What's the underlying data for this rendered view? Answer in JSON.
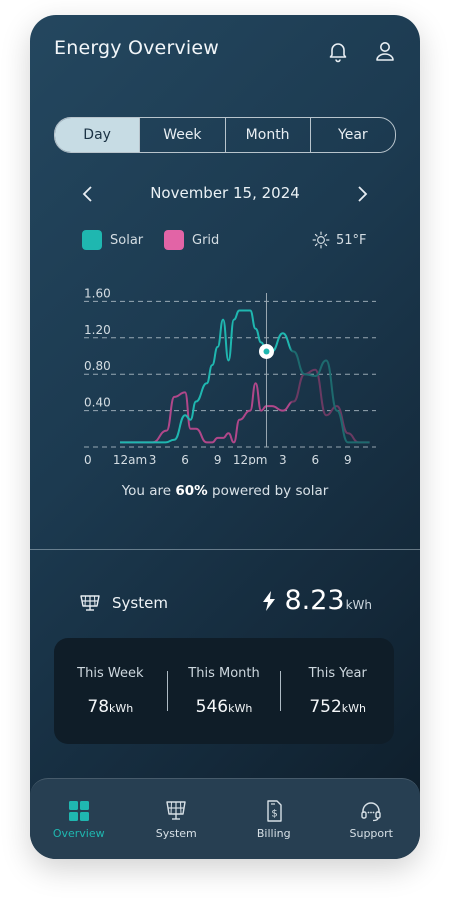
{
  "header": {
    "title": "Energy Overview",
    "notification_icon": "bell-icon",
    "profile_icon": "user-icon"
  },
  "range_tabs": [
    {
      "label": "Day",
      "active": true
    },
    {
      "label": "Week",
      "active": false
    },
    {
      "label": "Month",
      "active": false
    },
    {
      "label": "Year",
      "active": false
    }
  ],
  "date_nav": {
    "date": "November 15, 2024"
  },
  "legend": {
    "solar": "Solar",
    "grid": "Grid",
    "temperature": "51°F"
  },
  "colors": {
    "solar": "#1fb7b0",
    "grid": "#b1478a",
    "active_tab": "#1fb7b0",
    "segment_active": "#c7dce4"
  },
  "chart_data": {
    "type": "line",
    "ylim": [
      0,
      2.0
    ],
    "y_ticks": [
      "0",
      "0.40",
      "0.80",
      "1.20",
      "1.60"
    ],
    "y_tick_values": [
      0,
      0.4,
      0.8,
      1.2,
      1.6
    ],
    "x_ticks": [
      "12am",
      "3",
      "6",
      "9",
      "12pm",
      "3",
      "6",
      "9"
    ],
    "x_tick_hours": [
      0,
      3,
      6,
      9,
      12,
      15,
      18,
      21
    ],
    "xlim": [
      0,
      23.5
    ],
    "cursor_hour": 13.5,
    "series": [
      {
        "name": "Solar",
        "x": [
          0,
          3,
          4.2,
          5,
          6,
          6.5,
          7,
          8,
          8.5,
          9,
          9.5,
          10,
          10.5,
          11,
          12,
          12.5,
          13,
          13.5,
          14,
          15,
          16,
          17,
          18,
          19,
          20,
          21,
          22,
          22.5,
          23
        ],
        "y": [
          0.05,
          0.05,
          0.05,
          0.08,
          0.35,
          0.3,
          0.5,
          0.7,
          0.9,
          1.1,
          1.4,
          0.95,
          1.4,
          1.5,
          1.5,
          1.3,
          1.15,
          1.05,
          1.05,
          1.25,
          1.05,
          0.8,
          0.78,
          0.95,
          0.4,
          0.05,
          0.05,
          0.05,
          0.05
        ]
      },
      {
        "name": "Grid",
        "x": [
          0,
          3,
          4.3,
          5,
          6,
          6.5,
          7,
          8,
          8.5,
          9,
          9.5,
          10,
          10.5,
          11,
          12,
          12.5,
          13,
          13.5,
          14,
          15,
          16,
          17,
          18,
          19,
          20,
          21,
          22,
          22.5,
          23
        ],
        "y": [
          0.05,
          0.05,
          0.18,
          0.55,
          0.6,
          0.2,
          0.2,
          0.05,
          0.05,
          0.1,
          0.1,
          0.15,
          0.05,
          0.3,
          0.4,
          0.7,
          0.4,
          0.45,
          0.45,
          0.4,
          0.5,
          0.8,
          0.85,
          0.35,
          0.45,
          0.15,
          0.05,
          0.05,
          0.05
        ]
      }
    ]
  },
  "solar_message": {
    "prefix": "You are ",
    "percent": "60%",
    "suffix": " powered by solar"
  },
  "system": {
    "label": "System",
    "value": "8.23",
    "unit": "kWh"
  },
  "stats": [
    {
      "label": "This Week",
      "value": "78",
      "unit": "kWh"
    },
    {
      "label": "This Month",
      "value": "546",
      "unit": "kWh"
    },
    {
      "label": "This Year",
      "value": "752",
      "unit": "kWh"
    }
  ],
  "tabbar": [
    {
      "label": "Overview",
      "icon": "grid-icon",
      "active": true
    },
    {
      "label": "System",
      "icon": "solar-panel-icon",
      "active": false
    },
    {
      "label": "Billing",
      "icon": "bill-icon",
      "active": false
    },
    {
      "label": "Support",
      "icon": "headset-icon",
      "active": false
    }
  ]
}
